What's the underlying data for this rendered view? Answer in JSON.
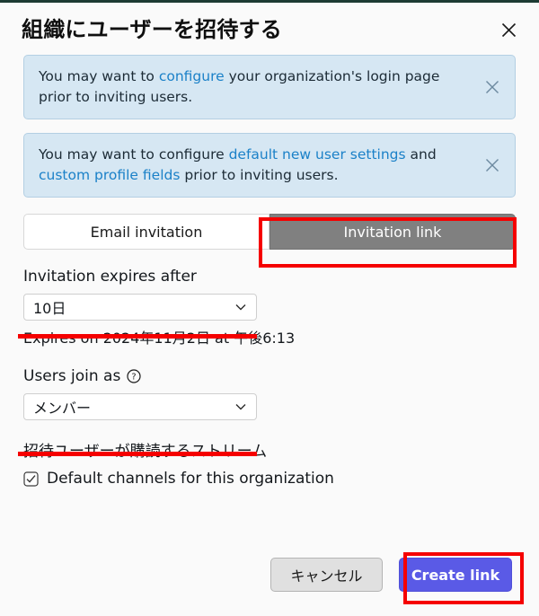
{
  "window": {
    "accent_strip_color": "#1d3b33"
  },
  "header": {
    "title": "組織にユーザーを招待する",
    "close_icon": "close-icon"
  },
  "alerts": [
    {
      "id": "login-page-alert",
      "segments": [
        {
          "type": "text",
          "text": "You may want to "
        },
        {
          "type": "link",
          "text": "configure"
        },
        {
          "type": "text",
          "text": " your organization's login page prior to inviting users."
        }
      ],
      "close_icon": "close-icon"
    },
    {
      "id": "new-user-settings-alert",
      "segments": [
        {
          "type": "text",
          "text": "You may want to configure "
        },
        {
          "type": "link",
          "text": "default new user settings"
        },
        {
          "type": "text",
          "text": " and "
        },
        {
          "type": "link",
          "text": "custom profile fields"
        },
        {
          "type": "text",
          "text": " prior to inviting users."
        }
      ],
      "close_icon": "close-icon"
    }
  ],
  "tabs": [
    {
      "label": "Email invitation",
      "active": false
    },
    {
      "label": "Invitation link",
      "active": true
    }
  ],
  "expires_field": {
    "label": "Invitation expires after",
    "value": "10日",
    "chevron_icon": "chevron-down-icon",
    "hint": "Expires on 2024年11月2日 at 午後6:13"
  },
  "join_as_field": {
    "label": "Users join as",
    "help_icon": "help-circle-icon",
    "value": "メンバー",
    "chevron_icon": "chevron-down-icon"
  },
  "streams_section": {
    "heading": "招待ユーザーが購読するストリーム",
    "checkbox": {
      "label": "Default channels for this organization",
      "checked": true,
      "icon": "checkbox-checked-icon"
    }
  },
  "footer": {
    "cancel_label": "キャンセル",
    "create_link_label": "Create link"
  },
  "annotations": {
    "color": "#f50000",
    "items": [
      {
        "name": "invitation-link-tab-highlight",
        "shape": "box"
      },
      {
        "name": "expires-select-highlight",
        "shape": "underline"
      },
      {
        "name": "join-as-select-highlight",
        "shape": "underline"
      },
      {
        "name": "create-link-button-highlight",
        "shape": "box"
      }
    ]
  }
}
